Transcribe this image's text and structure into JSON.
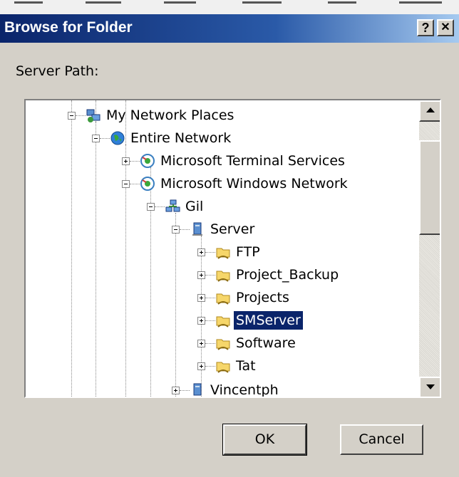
{
  "dialog": {
    "title": "Browse for Folder",
    "help_glyph": "?",
    "close_glyph": "✕"
  },
  "server_path_label": "Server Path:",
  "tree": {
    "items": [
      {
        "label": "My Network Places",
        "icon": "network-places-icon",
        "expander": "minus"
      },
      {
        "label": "Entire Network",
        "icon": "globe-icon",
        "expander": "minus"
      },
      {
        "label": "Microsoft Terminal Services",
        "icon": "terminal-services-icon",
        "expander": "plus"
      },
      {
        "label": "Microsoft Windows Network",
        "icon": "windows-network-icon",
        "expander": "minus"
      },
      {
        "label": "Gil",
        "icon": "workgroup-icon",
        "expander": "minus"
      },
      {
        "label": "Server",
        "icon": "computer-icon",
        "expander": "minus"
      },
      {
        "label": "FTP",
        "icon": "shared-folder-icon",
        "expander": "plus"
      },
      {
        "label": "Project_Backup",
        "icon": "shared-folder-icon",
        "expander": "plus"
      },
      {
        "label": "Projects",
        "icon": "shared-folder-icon",
        "expander": "plus"
      },
      {
        "label": "SMServer",
        "icon": "shared-folder-icon",
        "expander": "plus",
        "selected": true
      },
      {
        "label": "Software",
        "icon": "shared-folder-icon",
        "expander": "plus"
      },
      {
        "label": "Tat",
        "icon": "shared-folder-icon",
        "expander": "plus"
      },
      {
        "label": "Vincentph",
        "icon": "computer-icon",
        "expander": "plus"
      }
    ]
  },
  "buttons": {
    "ok": "OK",
    "cancel": "Cancel"
  },
  "colors": {
    "selection": "#0a246a",
    "dialog_bg": "#d4d0c8"
  }
}
